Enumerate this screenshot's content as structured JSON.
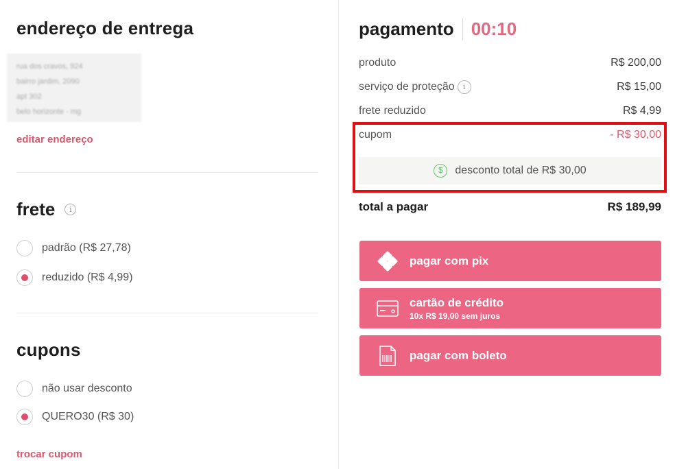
{
  "delivery": {
    "title": "endereço de entrega",
    "address_lines": [
      "rua dos cravos, 924",
      "bairro jardim, 2090",
      "apt 302",
      "belo horizonte - mg"
    ],
    "edit_link": "editar endereço"
  },
  "shipping": {
    "title": "frete",
    "info_icon": "info-icon",
    "options": [
      {
        "label": "padrão (R$ 27,78)",
        "selected": false
      },
      {
        "label": "reduzido (R$ 4,99)",
        "selected": true
      }
    ]
  },
  "coupons": {
    "title": "cupons",
    "options": [
      {
        "label": "não usar desconto",
        "selected": false
      },
      {
        "label": "QUERO30 (R$ 30)",
        "selected": true
      }
    ],
    "change_link": "trocar cupom"
  },
  "payment": {
    "title": "pagamento",
    "timer": "00:10",
    "rows": [
      {
        "label": "produto",
        "value": "R$ 200,00"
      },
      {
        "label": "serviço de proteção",
        "value": "R$ 15,00"
      },
      {
        "label": "frete reduzido",
        "value": "R$ 4,99"
      }
    ],
    "coupon": {
      "label": "cupom",
      "value": "- R$ 30,00"
    },
    "discount_note": "desconto total de R$ 30,00",
    "total": {
      "label": "total a pagar",
      "value": "R$ 189,99"
    },
    "buttons": [
      {
        "label": "pagar com pix",
        "icon": "pix-icon"
      },
      {
        "label": "cartão de crédito",
        "sub": "10x R$ 19,00 sem juros",
        "icon": "credit-card-icon"
      },
      {
        "label": "pagar com boleto",
        "icon": "barcode-icon"
      }
    ]
  },
  "colors": {
    "accent": "#ec6683",
    "link": "#d9586f",
    "highlight": "#e00f14",
    "success": "#69c06f"
  }
}
